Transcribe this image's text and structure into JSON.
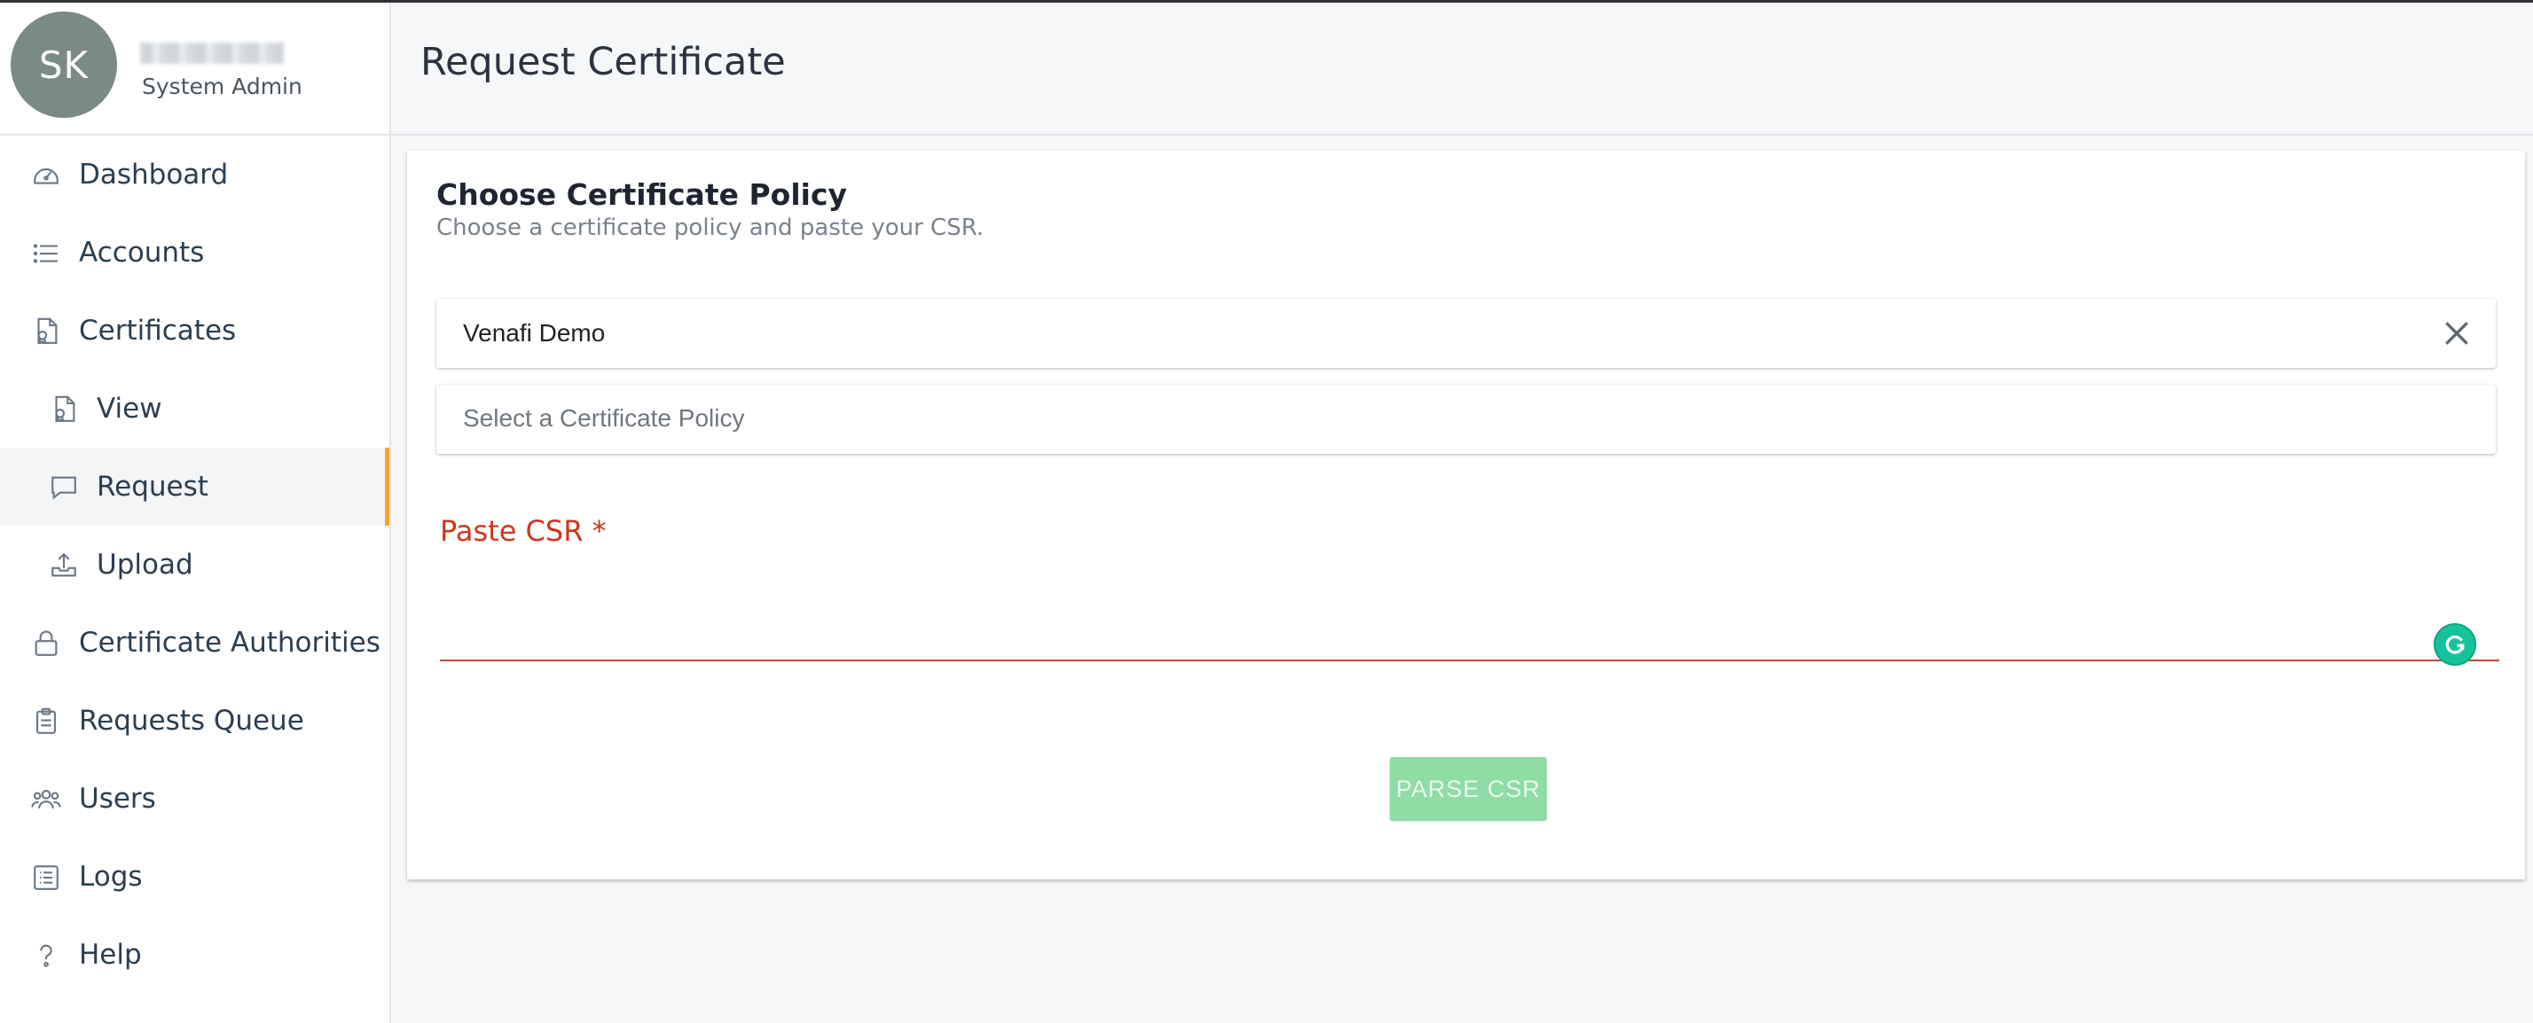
{
  "user": {
    "initials": "SK",
    "role": "System Admin"
  },
  "sidebar": {
    "items": [
      {
        "label": "Dashboard",
        "icon": "gauge-icon"
      },
      {
        "label": "Accounts",
        "icon": "list-icon"
      },
      {
        "label": "Certificates",
        "icon": "certificate-icon"
      },
      {
        "label": "View",
        "icon": "certificate-icon"
      },
      {
        "label": "Request",
        "icon": "chat-bubble-icon"
      },
      {
        "label": "Upload",
        "icon": "upload-icon"
      },
      {
        "label": "Certificate Authorities",
        "icon": "lock-icon"
      },
      {
        "label": "Requests Queue",
        "icon": "clipboard-icon"
      },
      {
        "label": "Users",
        "icon": "users-icon"
      },
      {
        "label": "Logs",
        "icon": "log-list-icon"
      },
      {
        "label": "Help",
        "icon": "help-icon"
      }
    ],
    "active_item": "Request",
    "active_color": "#f5a623"
  },
  "header": {
    "title": "Request Certificate"
  },
  "card": {
    "title": "Choose Certificate Policy",
    "subtitle": "Choose a certificate policy and paste your CSR.",
    "search_value": "Venafi Demo",
    "policy_placeholder": "Select a Certificate Policy",
    "csr_label": "Paste CSR *",
    "csr_value": "",
    "parse_button": "PARSE CSR"
  },
  "colors": {
    "error": "#d0351e",
    "button_disabled": "#8fdca5",
    "avatar": "#7a8a87"
  }
}
